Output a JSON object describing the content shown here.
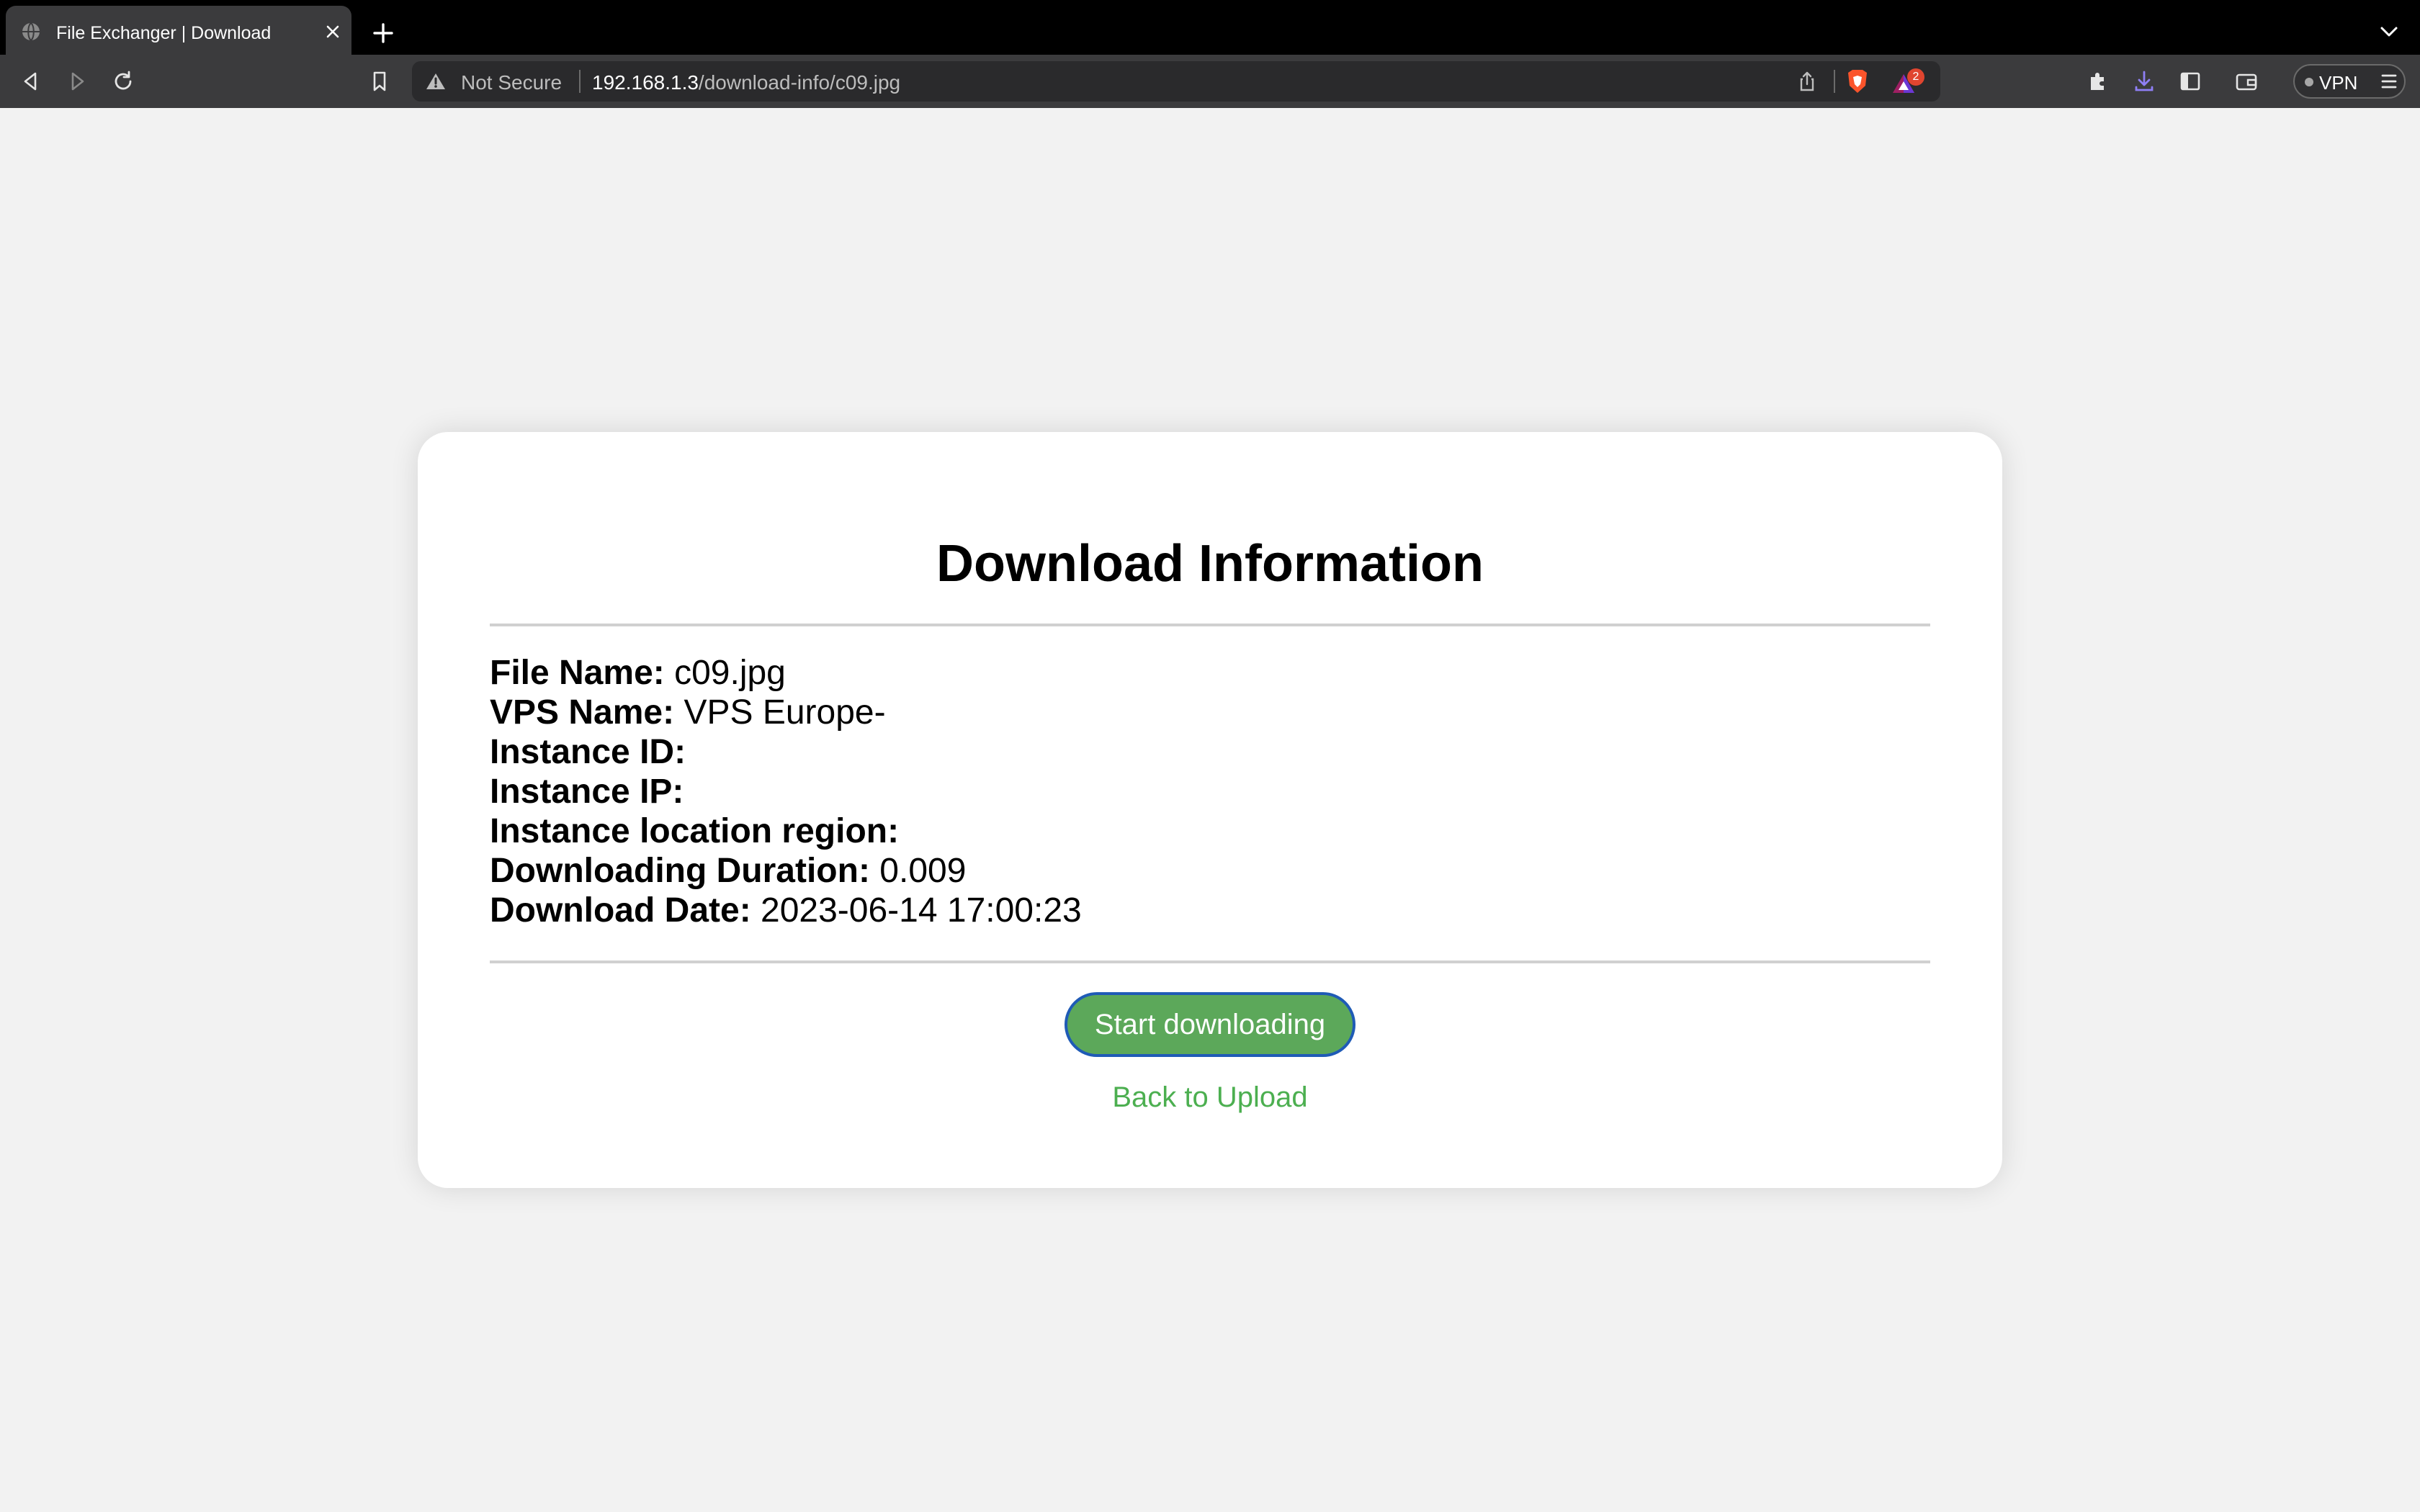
{
  "browser": {
    "tab": {
      "title": "File Exchanger | Download",
      "favicon": "globe-icon"
    },
    "omnibox": {
      "security_label": "Not Secure",
      "url_host": "192.168.1.3",
      "url_path": "/download-info/c09.jpg"
    },
    "rewards_badge": "2",
    "vpn_label": "VPN"
  },
  "page": {
    "title": "Download Information",
    "fields": [
      {
        "label": "File Name:",
        "value": "c09.jpg"
      },
      {
        "label": "VPS Name:",
        "value": "VPS Europe-"
      },
      {
        "label": "Instance ID:",
        "value": ""
      },
      {
        "label": "Instance IP:",
        "value": ""
      },
      {
        "label": "Instance location region:",
        "value": ""
      },
      {
        "label": "Downloading Duration:",
        "value": "0.009"
      },
      {
        "label": "Download Date:",
        "value": "2023-06-14 17:00:23"
      }
    ],
    "start_button": "Start downloading",
    "back_link": "Back to Upload"
  },
  "colors": {
    "button_bg": "#5ca85a",
    "button_border": "#1f5bb6",
    "link": "#4caf50",
    "page_bg": "#f2f2f2"
  }
}
